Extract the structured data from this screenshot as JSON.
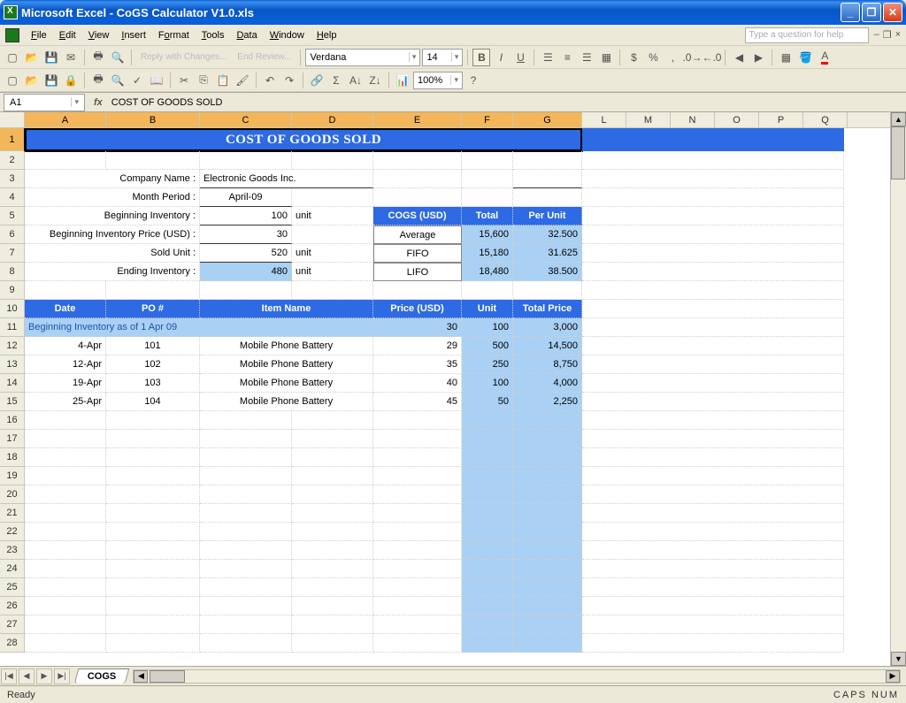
{
  "window": {
    "title": "Microsoft Excel - CoGS Calculator V1.0.xls"
  },
  "menu": {
    "file": "File",
    "edit": "Edit",
    "view": "View",
    "insert": "Insert",
    "format": "Format",
    "tools": "Tools",
    "data": "Data",
    "window": "Window",
    "help": "Help",
    "helpPlaceholder": "Type a question for help"
  },
  "toolbar2": {
    "reply": "Reply with Changes...",
    "endreview": "End Review...",
    "font": "Verdana",
    "size": "14",
    "zoom": "100%"
  },
  "namebox": "A1",
  "formula": "COST OF GOODS SOLD",
  "columns": [
    "A",
    "B",
    "C",
    "D",
    "E",
    "F",
    "G",
    "L",
    "M",
    "N",
    "O",
    "P",
    "Q"
  ],
  "sheet": {
    "title": "COST OF GOODS SOLD",
    "labels": {
      "company": "Company Name :",
      "month": "Month Period :",
      "beginv": "Beginning Inventory :",
      "beginvprice": "Beginning Inventory Price (USD) :",
      "sold": "Sold Unit :",
      "endinv": "Ending Inventory :",
      "unit": "unit"
    },
    "company": "Electronic Goods Inc.",
    "month": "April-09",
    "beginv": "100",
    "beginvprice": "30",
    "sold": "520",
    "endinv": "480",
    "cogs": {
      "hdr": {
        "cogs": "COGS (USD)",
        "total": "Total",
        "perunit": "Per Unit"
      },
      "rows": [
        {
          "m": "Average",
          "t": "15,600",
          "p": "32.500"
        },
        {
          "m": "FIFO",
          "t": "15,180",
          "p": "31.625"
        },
        {
          "m": "LIFO",
          "t": "18,480",
          "p": "38.500"
        }
      ]
    },
    "table": {
      "hdr": {
        "date": "Date",
        "po": "PO #",
        "item": "Item Name",
        "price": "Price (USD)",
        "unit": "Unit",
        "total": "Total Price"
      },
      "beginrow": {
        "label": "Beginning Inventory as of  1 Apr 09",
        "price": "30",
        "unit": "100",
        "total": "3,000"
      },
      "rows": [
        {
          "date": "4-Apr",
          "po": "101",
          "item": "Mobile Phone Battery",
          "price": "29",
          "unit": "500",
          "total": "14,500"
        },
        {
          "date": "12-Apr",
          "po": "102",
          "item": "Mobile Phone Battery",
          "price": "35",
          "unit": "250",
          "total": "8,750"
        },
        {
          "date": "19-Apr",
          "po": "103",
          "item": "Mobile Phone Battery",
          "price": "40",
          "unit": "100",
          "total": "4,000"
        },
        {
          "date": "25-Apr",
          "po": "104",
          "item": "Mobile Phone Battery",
          "price": "45",
          "unit": "50",
          "total": "2,250"
        }
      ]
    }
  },
  "tabs": {
    "name": "COGS"
  },
  "status": {
    "ready": "Ready",
    "caps": "CAPS NUM"
  }
}
